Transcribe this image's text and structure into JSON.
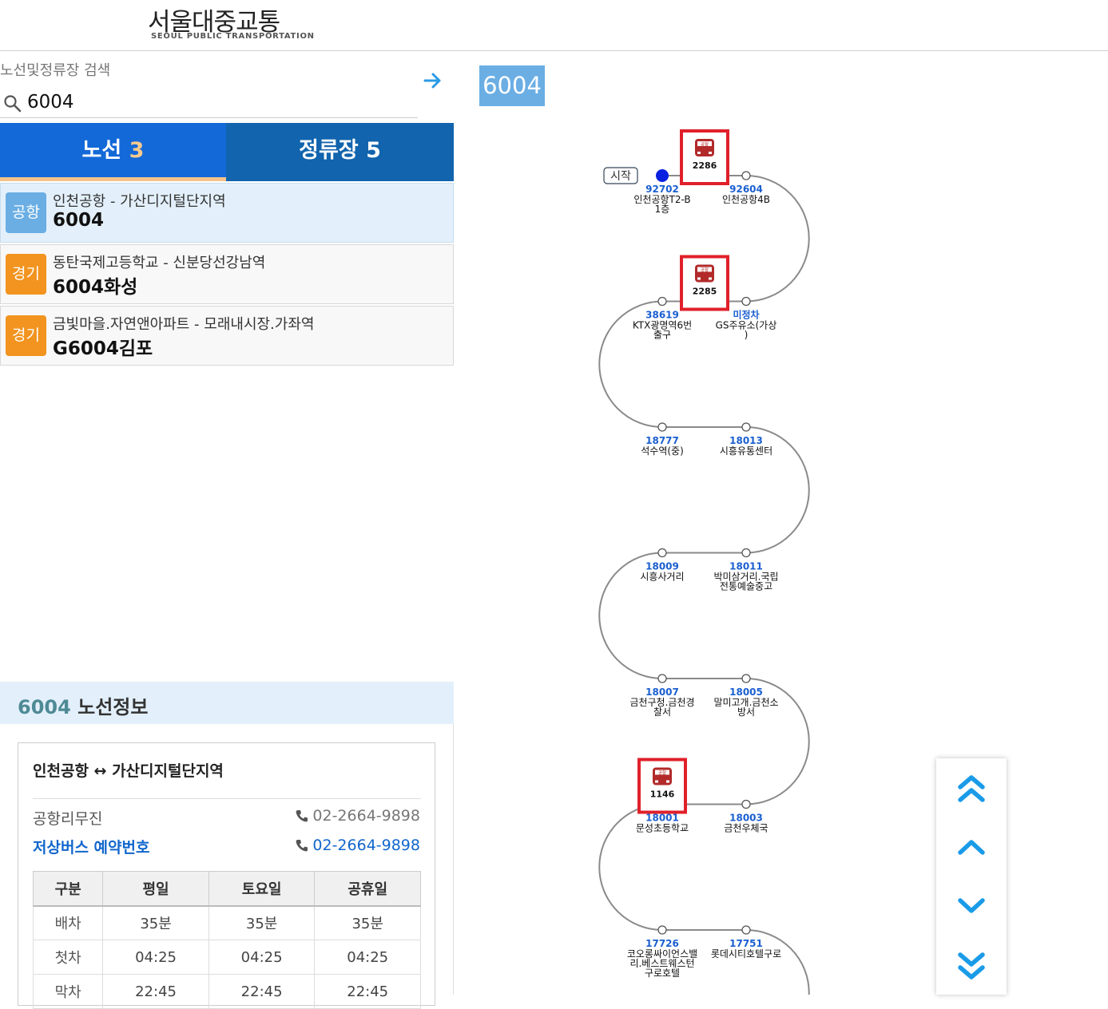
{
  "header": {
    "logo_title": "서울대중교통",
    "logo_subtitle": "SEOUL PUBLIC TRANSPORTATION"
  },
  "search": {
    "label": "노선및정류장 검색",
    "value": "6004"
  },
  "tabs": {
    "routes_label": "노선",
    "routes_count": "3",
    "stops_label": "정류장",
    "stops_count": "5"
  },
  "results": [
    {
      "badge": "공항",
      "badge_color": "#6aaee4",
      "desc": "인천공항 - 가산디지털단지역",
      "route": "6004",
      "selected": true
    },
    {
      "badge": "경기",
      "badge_color": "#f2941f",
      "desc": "동탄국제고등학교 - 신분당선강남역",
      "route": "6004화성",
      "selected": false
    },
    {
      "badge": "경기",
      "badge_color": "#f2941f",
      "desc": "금빛마을.자연앤아파트 - 모래내시장.가좌역",
      "route": "G6004김포",
      "selected": false
    }
  ],
  "route_info": {
    "title_num": "6004",
    "title_text": " 노선정보",
    "route_text": "인천공항 ↔ 가산디지털단지역",
    "company": "공항리무진",
    "company_phone": "02-2664-9898",
    "lowfloor_label": "저상버스 예약번호",
    "lowfloor_phone": "02-2664-9898",
    "schedule_headers": [
      "구분",
      "평일",
      "토요일",
      "공휴일"
    ],
    "schedule_rows": [
      [
        "배차",
        "35분",
        "35분",
        "35분"
      ],
      [
        "첫차",
        "04:25",
        "04:25",
        "04:25"
      ],
      [
        "막차",
        "22:45",
        "22:45",
        "22:45"
      ]
    ]
  },
  "map": {
    "route_number": "6004",
    "start_label": "시작",
    "bus_badge_text": "공항",
    "buses": [
      "2286",
      "2285",
      "1146"
    ],
    "stops": [
      {
        "id": "92702",
        "name": [
          "인천공항T2-B",
          "1층"
        ]
      },
      {
        "id": "92604",
        "name": [
          "인천공항4B"
        ]
      },
      {
        "id": "38619",
        "name": [
          "KTX광명역6번",
          "출구"
        ]
      },
      {
        "id": "미정차",
        "name": [
          "GS주유소(가상",
          ")"
        ]
      },
      {
        "id": "18777",
        "name": [
          "석수역(중)"
        ]
      },
      {
        "id": "18013",
        "name": [
          "시흥유통센터"
        ]
      },
      {
        "id": "18009",
        "name": [
          "시흥사거리"
        ]
      },
      {
        "id": "18011",
        "name": [
          "박미삼거리.국립",
          "전통예술중고"
        ]
      },
      {
        "id": "18007",
        "name": [
          "금천구청.금천경",
          "찰서"
        ]
      },
      {
        "id": "18005",
        "name": [
          "말미고개.금천소",
          "방서"
        ]
      },
      {
        "id": "18001",
        "name": [
          "문성초등학교"
        ]
      },
      {
        "id": "18003",
        "name": [
          "금천우체국"
        ]
      },
      {
        "id": "17726",
        "name": [
          "코오롱싸이언스밸",
          "리.베스트웨스턴",
          "구로호텔"
        ]
      },
      {
        "id": "17751",
        "name": [
          "롯데시티호텔구로"
        ]
      }
    ],
    "colors": {
      "line": "#8a8a8a",
      "stop_id": "#1a5fd0",
      "current_stop": "#0a20e0",
      "bus_highlight": "#e0202a",
      "bus_body": "#b22a2a"
    }
  },
  "scroll_controls": [
    "chevrons-up-icon",
    "chevron-up-icon",
    "chevron-down-icon",
    "chevrons-down-icon"
  ]
}
